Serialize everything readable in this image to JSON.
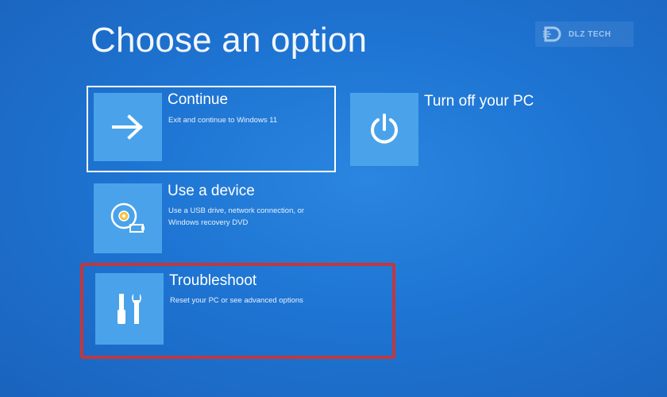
{
  "page": {
    "title": "Choose an option"
  },
  "watermark": {
    "text": "DLZ TECH"
  },
  "options": [
    {
      "id": "continue",
      "title": "Continue",
      "description": "Exit and continue to Windows 11",
      "icon": "arrow-right-icon"
    },
    {
      "id": "turn-off",
      "title": "Turn off your PC",
      "description": "",
      "icon": "power-icon"
    },
    {
      "id": "use-device",
      "title": "Use a device",
      "description_lines": [
        "Use a USB drive, network connection, or",
        "Windows recovery DVD"
      ],
      "icon": "disc-drive-icon"
    },
    {
      "id": "troubleshoot",
      "title": "Troubleshoot",
      "description": "Reset your PC or see advanced options",
      "icon": "tools-icon"
    }
  ],
  "colors": {
    "background": "#1e74d2",
    "tile": "#4aa3ea",
    "highlight": "#c0383f",
    "focus": "#ffffff"
  }
}
